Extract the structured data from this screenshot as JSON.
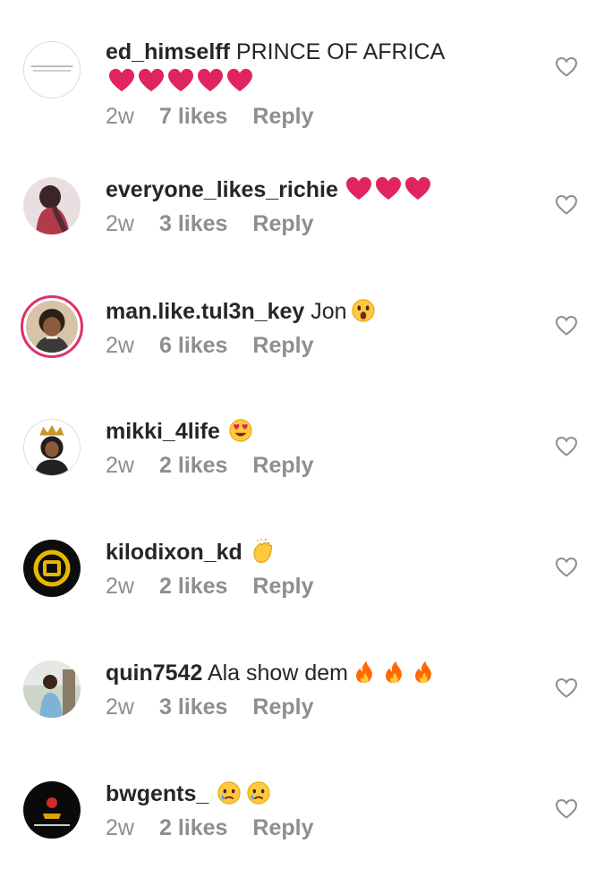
{
  "comments": [
    {
      "username": "ed_himselff",
      "text": "PRINCE OF AFRICA",
      "emojis": [
        "heart",
        "heart",
        "heart",
        "heart",
        "heart"
      ],
      "time": "2w",
      "likes": "7 likes",
      "reply": "Reply",
      "avatar": "white-logo"
    },
    {
      "username": "everyone_likes_richie",
      "text": "",
      "emojis": [
        "heart",
        "heart",
        "heart"
      ],
      "time": "2w",
      "likes": "3 likes",
      "reply": "Reply",
      "avatar": "photo-pink"
    },
    {
      "username": "man.like.tul3n_key",
      "text": "Jon",
      "emojis": [
        "astonished-face"
      ],
      "time": "2w",
      "likes": "6 likes",
      "reply": "Reply",
      "avatar": "cartoon-ring"
    },
    {
      "username": "mikki_4life",
      "text": "",
      "emojis": [
        "heart-eyes-face"
      ],
      "time": "2w",
      "likes": "2 likes",
      "reply": "Reply",
      "avatar": "queen-drawing"
    },
    {
      "username": "kilodixon_kd",
      "text": "",
      "emojis": [
        "clapping-hands"
      ],
      "time": "2w",
      "likes": "2 likes",
      "reply": "Reply",
      "avatar": "gold-logo"
    },
    {
      "username": "quin7542",
      "text": "Ala show dem",
      "emojis": [
        "fire",
        "fire",
        "fire"
      ],
      "time": "2w",
      "likes": "3 likes",
      "reply": "Reply",
      "avatar": "photo-outdoor"
    },
    {
      "username": "bwgents_",
      "text": "",
      "emojis": [
        "crying-face",
        "crying-face"
      ],
      "time": "2w",
      "likes": "2 likes",
      "reply": "Reply",
      "avatar": "dark-logo"
    }
  ],
  "colors": {
    "heart": "#e0245e",
    "meta": "#8e8e8e",
    "text": "#262626",
    "ring": "#e1306c"
  },
  "icons": {
    "like": "heart-outline-icon"
  }
}
